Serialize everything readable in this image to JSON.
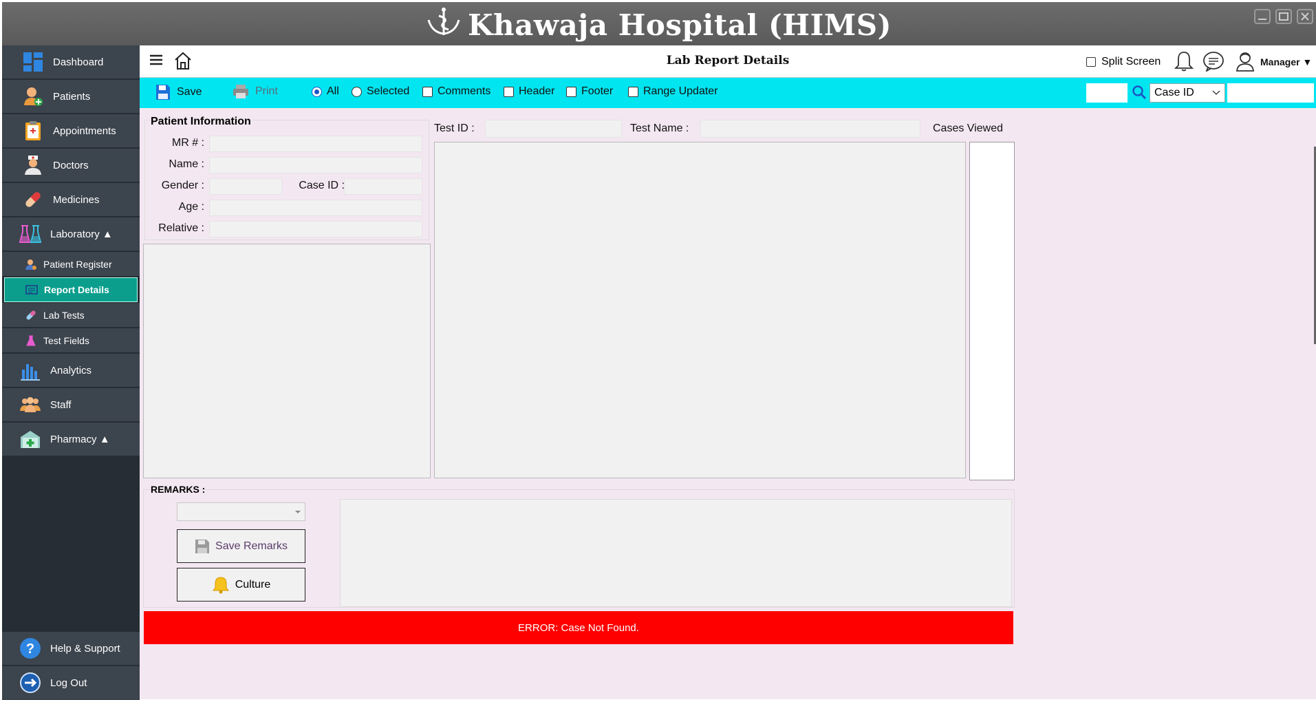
{
  "app": {
    "title": "Khawaja Hospital (HIMS)"
  },
  "sidebar": {
    "items": [
      {
        "label": "Dashboard",
        "icon": "dashboard-icon"
      },
      {
        "label": "Patients",
        "icon": "patient-icon"
      },
      {
        "label": "Appointments",
        "icon": "clipboard-icon"
      },
      {
        "label": "Doctors",
        "icon": "doctor-icon"
      },
      {
        "label": "Medicines",
        "icon": "pill-icon"
      },
      {
        "label": "Laboratory ▲",
        "icon": "flask-icon"
      }
    ],
    "lab_sub": [
      {
        "label": "Patient Register",
        "icon": "user-icon"
      },
      {
        "label": "Report Details",
        "icon": "report-icon",
        "active": true
      },
      {
        "label": "Lab Tests",
        "icon": "pill-icon"
      },
      {
        "label": "Test Fields",
        "icon": "flask-icon"
      }
    ],
    "items2": [
      {
        "label": "Analytics",
        "icon": "chart-icon"
      },
      {
        "label": "Staff",
        "icon": "group-icon"
      },
      {
        "label": "Pharmacy ▲",
        "icon": "pharmacy-icon"
      }
    ],
    "bottom": [
      {
        "label": "Help & Support",
        "icon": "help-icon"
      },
      {
        "label": "Log Out",
        "icon": "logout-icon"
      }
    ]
  },
  "topbar": {
    "page_title": "Lab Report Details",
    "split_screen_label": "Split Screen",
    "user_label": "Manager ▼"
  },
  "toolbar": {
    "save_label": "Save",
    "print_label": "Print",
    "all_label": "All",
    "selected_label": "Selected",
    "comments_label": "Comments",
    "header_label": "Header",
    "footer_label": "Footer",
    "range_updater_label": "Range Updater",
    "search_select": "Case ID"
  },
  "patient_info": {
    "heading": "Patient Information",
    "mr_label": "MR # :",
    "name_label": "Name :",
    "gender_label": "Gender :",
    "case_id_label": "Case ID :",
    "age_label": "Age :",
    "relative_label": "Relative :"
  },
  "test": {
    "test_id_label": "Test ID :",
    "test_name_label": "Test Name :",
    "cases_viewed_label": "Cases Viewed"
  },
  "remarks": {
    "heading": "REMARKS :",
    "save_remarks_label": "Save Remarks",
    "culture_label": "Culture"
  },
  "status": {
    "error_message": "ERROR: Case Not Found."
  },
  "colors": {
    "toolbar": "#00e5f0",
    "sidebar_item": "#3c444d",
    "sidebar_active": "#0b9e8d",
    "main_bg": "#f3e7f1",
    "error": "#ff0000"
  }
}
